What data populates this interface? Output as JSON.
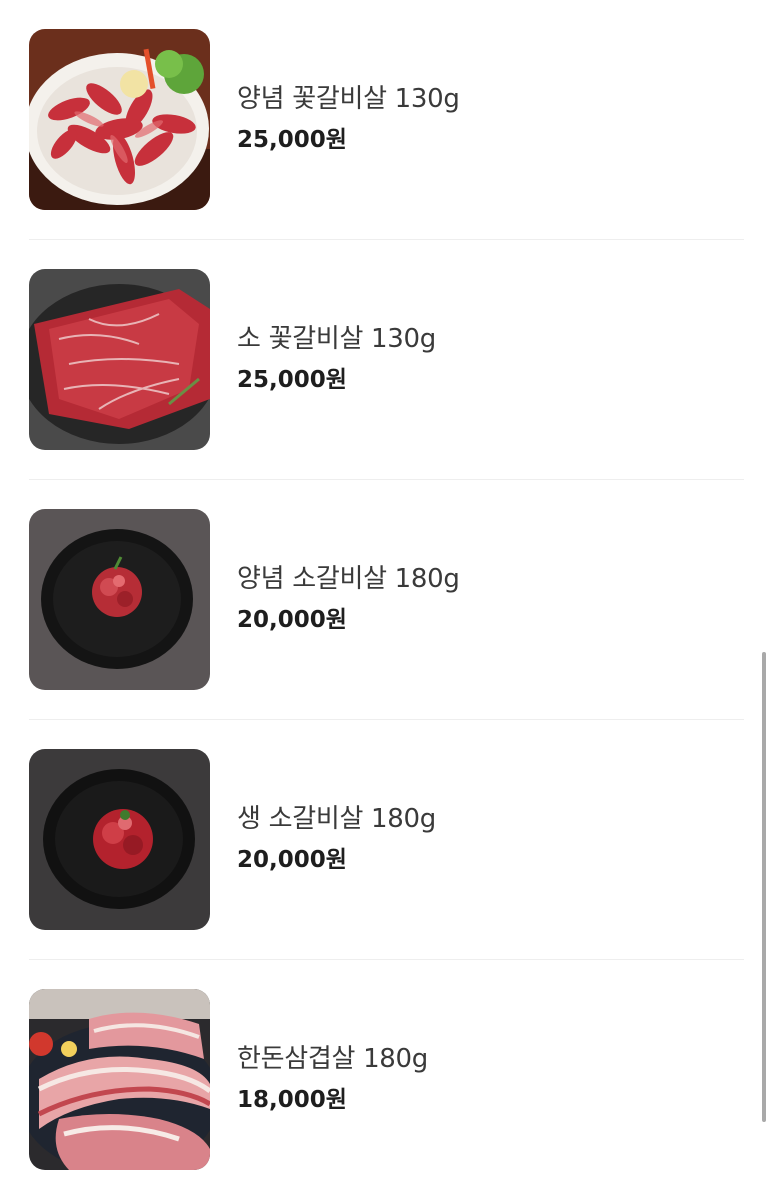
{
  "menu": {
    "items": [
      {
        "name": "양념 꽃갈비살 130g",
        "price": "25,000원",
        "image": "marinated-short-rib-platter"
      },
      {
        "name": "소 꽃갈비살 130g",
        "price": "25,000원",
        "image": "beef-short-rib-on-slate"
      },
      {
        "name": "양념 소갈비살 180g",
        "price": "20,000원",
        "image": "marinated-rib-on-black-plate"
      },
      {
        "name": "생 소갈비살 180g",
        "price": "20,000원",
        "image": "raw-rib-on-black-plate"
      },
      {
        "name": "한돈삼겹살 180g",
        "price": "18,000원",
        "image": "pork-belly-on-tray"
      }
    ]
  },
  "colors": {
    "price_text": "#1e1e1e",
    "name_text": "#3a3a3a",
    "divider": "#eeeeee",
    "scrollbar": "#a9a9a9"
  }
}
